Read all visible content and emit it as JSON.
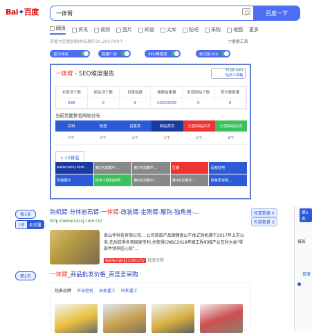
{
  "logo": {
    "bai": "Bai",
    "du": "百度"
  },
  "search": {
    "value": "一体臂",
    "button": "百度一下"
  },
  "tabs": [
    {
      "label": "网页"
    },
    {
      "label": "资讯"
    },
    {
      "label": "视频"
    },
    {
      "label": "图片"
    },
    {
      "label": "知道"
    },
    {
      "label": "文库"
    },
    {
      "label": "贴吧"
    },
    {
      "label": "采购"
    },
    {
      "label": "地图"
    },
    {
      "label": "更多"
    }
  ],
  "result_info": "百度为您找到相关结果约10,200,000个",
  "search_tools": "搜索工具",
  "toggles": [
    {
      "label": "显示排名"
    },
    {
      "label": "隐藏广告"
    },
    {
      "label": "SEO难度度"
    },
    {
      "label": "标记前100"
    }
  ],
  "seo": {
    "title_prefix": "一体臂",
    "title_suffix": " - SEO难度报告",
    "logo_line1": "5118.com",
    "logo_line2": "站长工具箱",
    "headers": [
      "长尾词个数",
      "相关词个数",
      "百度指数",
      "搜索结果量",
      "发现网站个数",
      "竞价数数量"
    ],
    "values": [
      "698",
      "0",
      "0",
      "10200000",
      "0",
      "0"
    ],
    "dist_title": "当前页面排名网站分布",
    "dist_headers": [
      "百科",
      "知道",
      "百度系",
      "网站首页",
      "大型网站内页",
      "小型网站内页"
    ],
    "dist_colors": [
      "#2d5bd8",
      "#2d5bd8",
      "#2d5bd8",
      "#1a3aa0",
      "#e33",
      "#3cc05f"
    ],
    "dist_values": [
      "0个",
      "0个",
      "4个",
      "1个",
      "1个",
      "4个"
    ],
    "rank_tab": "1-10排名",
    "rank_cells": [
      "www.cacsj.com...",
      "第2名加载中...",
      "第3名加载中...",
      "豆瓣",
      "百度贴吧",
      "百度图片",
      "铁甲工程机械网",
      "第8名加载中...",
      "第9名加载中...",
      "百度爱采购..."
    ],
    "rank_colors": [
      "#1a3aa0",
      "#888",
      "#888",
      "#e33",
      "#2d5bd8",
      "#2d5bd8",
      "#3cc05f",
      "#888",
      "#888",
      "#2d5bd8"
    ]
  },
  "result1": {
    "badge": "第1名",
    "label_a": "1名",
    "label_b": "全流量",
    "title_a": "钩机臂-分体岩石臂-",
    "title_hl": "一体臂",
    "title_b": "-改装臂-金刚臂-履钩-独角兽-...",
    "url": "http://www.cacsj.com.cn/",
    "desc": "泉山手科技有限公司... 公司首款产品钢臂泉山牛体式钩机臂于2017年上市以来,先后获得多项国家专利,并获得CMBC2018年国工程机械产业互利大会\"零部件领异匠心奖\"...",
    "site": "www.cacsj.com.cn/",
    "snapshot": "百度快照",
    "btn_weight": "权重数据",
    "btn_ext": "外链数量",
    "weight_val": "0",
    "ext_val": "0"
  },
  "result2": {
    "badge": "第2名",
    "title_hl": "一体臂",
    "title_b": "_商品批发价格_百度爱采购",
    "tags": [
      "热推品牌",
      "开泽挖机",
      "天拓重工",
      "同和重工"
    ]
  },
  "sidebar": {
    "label": "第1名",
    "text_a": "城名",
    "text_b": "百度"
  }
}
